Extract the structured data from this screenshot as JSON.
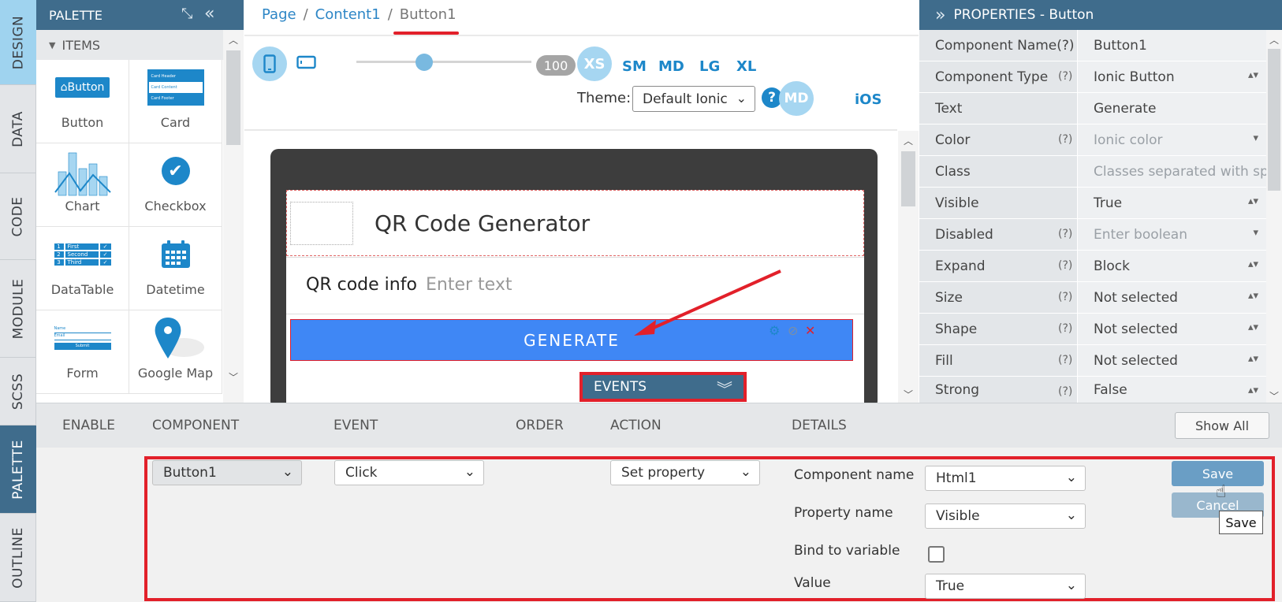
{
  "left_tabs": [
    "DESIGN",
    "DATA",
    "CODE",
    "MODULE",
    "SCSS",
    "PALETTE",
    "OUTLINE"
  ],
  "palette": {
    "title": "PALETTE",
    "section": "ITEMS",
    "items": [
      {
        "label": "Button",
        "thumb": "Button"
      },
      {
        "label": "Card",
        "thumb": [
          "Card Header",
          "Card Content",
          "Card Footer"
        ]
      },
      {
        "label": "Chart"
      },
      {
        "label": "Checkbox"
      },
      {
        "label": "DataTable",
        "thumb": [
          "First",
          "Second",
          "Third"
        ]
      },
      {
        "label": "Datetime"
      },
      {
        "label": "Form",
        "thumb": [
          "Name",
          "Email",
          "Submit"
        ]
      },
      {
        "label": "Google Map"
      }
    ]
  },
  "breadcrumb": {
    "items": [
      "Page",
      "Content1",
      "Button1"
    ],
    "separator": "/"
  },
  "toolbar": {
    "zoom": "100",
    "breakpoints": [
      "XS",
      "SM",
      "MD",
      "LG",
      "XL"
    ],
    "theme_label": "Theme:",
    "theme_value": "Default Ionic",
    "help": "?",
    "mode_md": "MD",
    "mode_ios": "iOS"
  },
  "canvas": {
    "header_title": "QR Code Generator",
    "qr_label": "QR code info",
    "qr_placeholder": "Enter text",
    "button_text": "GENERATE",
    "events_label": "EVENTS"
  },
  "properties": {
    "title": "PROPERTIES - Button",
    "help_marker": "(?)",
    "rows": [
      {
        "key": "Component Name(?)",
        "value": "Button1"
      },
      {
        "key": "Component Type",
        "value": "Ionic Button",
        "help": true
      },
      {
        "key": "Text",
        "value": "Generate"
      },
      {
        "key": "Color",
        "value": "Ionic color",
        "help": true
      },
      {
        "key": "Class",
        "value": "Classes separated with sp"
      },
      {
        "key": "Visible",
        "value": "True"
      },
      {
        "key": "Disabled",
        "value": "Enter boolean",
        "help": true
      },
      {
        "key": "Expand",
        "value": "Block",
        "help": true
      },
      {
        "key": "Size",
        "value": "Not selected",
        "help": true
      },
      {
        "key": "Shape",
        "value": "Not selected",
        "help": true
      },
      {
        "key": "Fill",
        "value": "Not selected",
        "help": true
      },
      {
        "key": "Strong",
        "value": "False",
        "help": true
      }
    ]
  },
  "events": {
    "columns": [
      "ENABLE",
      "COMPONENT",
      "EVENT",
      "ORDER",
      "ACTION",
      "DETAILS"
    ],
    "show_all": "Show All",
    "component": "Button1",
    "event": "Click",
    "action": "Set property",
    "details": {
      "component_name_label": "Component name",
      "component_name_value": "Html1",
      "property_name_label": "Property name",
      "property_name_value": "Visible",
      "bind_label": "Bind to variable",
      "value_label": "Value",
      "value_value": "True"
    },
    "save": "Save",
    "cancel": "Cancel",
    "tooltip": "Save"
  },
  "colors": {
    "accent": "#3f6c8c",
    "link": "#1d87c9",
    "highlight": "#e2202a",
    "button": "#3f87f5"
  }
}
